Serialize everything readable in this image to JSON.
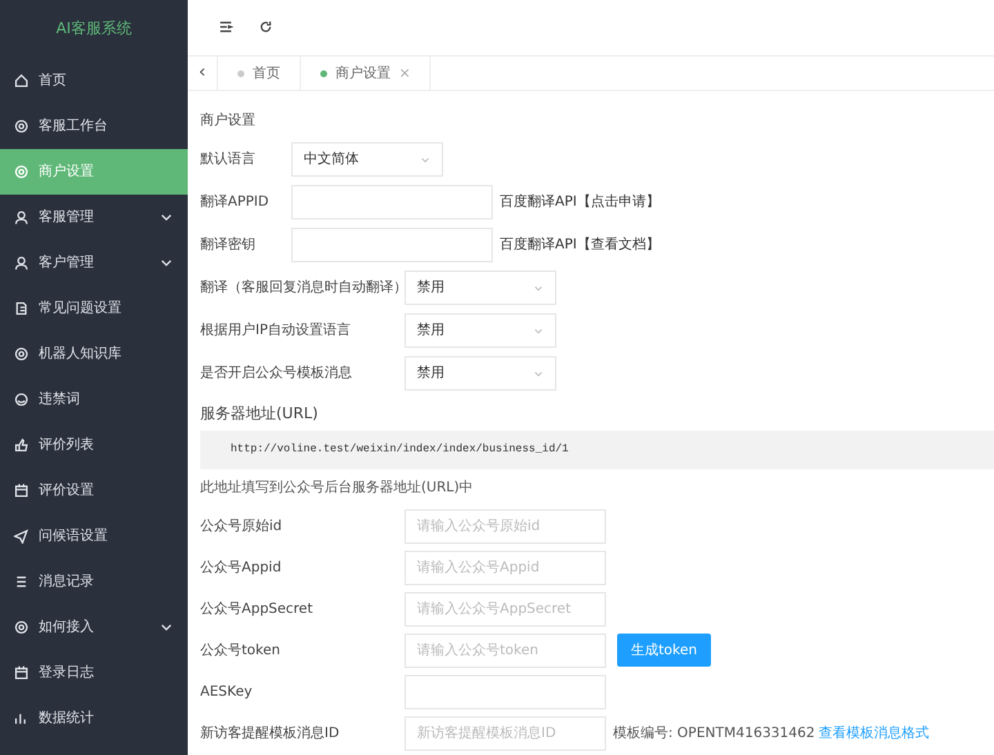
{
  "sidebar": {
    "logo": "AI客服系统",
    "items": [
      {
        "label": "首页",
        "selected": false,
        "expandable": false
      },
      {
        "label": "客服工作台",
        "selected": false,
        "expandable": false
      },
      {
        "label": "商户设置",
        "selected": true,
        "expandable": false
      },
      {
        "label": "客服管理",
        "selected": false,
        "expandable": true
      },
      {
        "label": "客户管理",
        "selected": false,
        "expandable": true
      },
      {
        "label": "常见问题设置",
        "selected": false,
        "expandable": false
      },
      {
        "label": "机器人知识库",
        "selected": false,
        "expandable": false
      },
      {
        "label": "违禁词",
        "selected": false,
        "expandable": false
      },
      {
        "label": "评价列表",
        "selected": false,
        "expandable": false
      },
      {
        "label": "评价设置",
        "selected": false,
        "expandable": false
      },
      {
        "label": "问候语设置",
        "selected": false,
        "expandable": false
      },
      {
        "label": "消息记录",
        "selected": false,
        "expandable": false
      },
      {
        "label": "如何接入",
        "selected": false,
        "expandable": true
      },
      {
        "label": "登录日志",
        "selected": false,
        "expandable": false
      },
      {
        "label": "数据统计",
        "selected": false,
        "expandable": false
      }
    ]
  },
  "tabs": [
    {
      "label": "首页",
      "selected": false,
      "closable": false
    },
    {
      "label": "商户设置",
      "selected": true,
      "closable": true
    }
  ],
  "close_glyph": "×",
  "back_glyph": "‹",
  "page_title": "商户设置",
  "form_rows": [
    {
      "kind": "select",
      "label": "默认语言",
      "value": "中文简体"
    },
    {
      "kind": "input",
      "label": "翻译APPID",
      "link": "百度翻译API【点击申请】"
    },
    {
      "kind": "input",
      "label": "翻译密钥",
      "link": "百度翻译API【查看文档】"
    },
    {
      "kind": "select",
      "label": "翻译（客服回复消息时自动翻译）",
      "value": "禁用"
    },
    {
      "kind": "select",
      "label": "根据用户IP自动设置语言",
      "value": "禁用"
    },
    {
      "kind": "select",
      "label": "是否开启公众号模板消息",
      "value": "禁用"
    }
  ],
  "server": {
    "title": "服务器地址(URL)",
    "url": "http://voline.test/weixin/index/index/business_id/1",
    "note": "此地址填写到公众号后台服务器地址(URL)中"
  },
  "wechat_rows": [
    {
      "label": "公众号原始id",
      "placeholder": "请输入公众号原始id"
    },
    {
      "label": "公众号Appid",
      "placeholder": "请输入公众号Appid"
    },
    {
      "label": "公众号AppSecret",
      "placeholder": "请输入公众号AppSecret"
    },
    {
      "label": "公众号token",
      "placeholder": "请输入公众号token",
      "button": "生成token"
    },
    {
      "label": "AESKey"
    },
    {
      "label": "新访客提醒模板消息ID",
      "placeholder": "新访客提醒模板消息ID",
      "note": "模板编号: OPENTM416331462",
      "note_link": "查看模板消息格式"
    }
  ]
}
